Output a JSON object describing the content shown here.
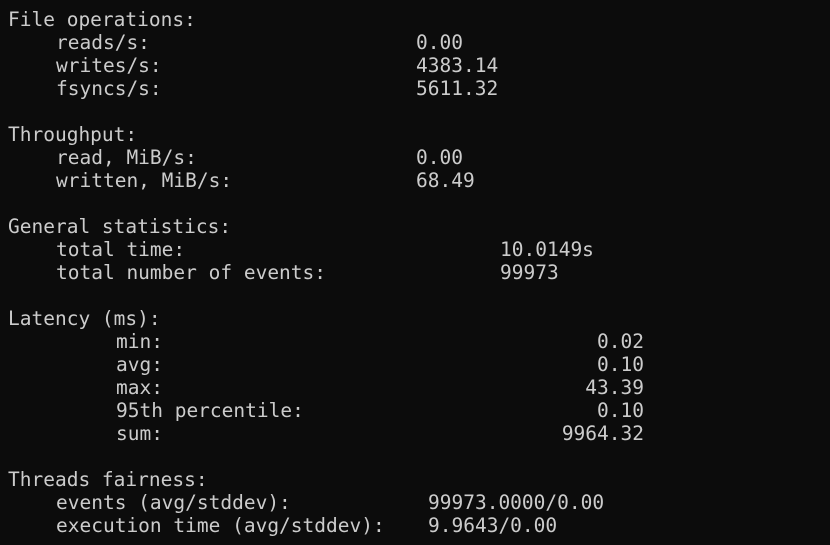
{
  "file_operations": {
    "header": "File operations:",
    "rows": [
      {
        "label": "reads/s:",
        "value": "0.00"
      },
      {
        "label": "writes/s:",
        "value": "4383.14"
      },
      {
        "label": "fsyncs/s:",
        "value": "5611.32"
      }
    ]
  },
  "throughput": {
    "header": "Throughput:",
    "rows": [
      {
        "label": "read, MiB/s:",
        "value": "0.00"
      },
      {
        "label": "written, MiB/s:",
        "value": "68.49"
      }
    ]
  },
  "general_statistics": {
    "header": "General statistics:",
    "rows": [
      {
        "label": "total time:",
        "value": "10.0149s"
      },
      {
        "label": "total number of events:",
        "value": "99973"
      }
    ]
  },
  "latency": {
    "header": "Latency (ms):",
    "rows": [
      {
        "label": "min:",
        "value": "0.02"
      },
      {
        "label": "avg:",
        "value": "0.10"
      },
      {
        "label": "max:",
        "value": "43.39"
      },
      {
        "label": "95th percentile:",
        "value": "0.10"
      },
      {
        "label": "sum:",
        "value": "9964.32"
      }
    ]
  },
  "threads_fairness": {
    "header": "Threads fairness:",
    "rows": [
      {
        "label": "events (avg/stddev):",
        "value": "99973.0000/0.00"
      },
      {
        "label": "execution time (avg/stddev):",
        "value": "9.9643/0.00"
      }
    ]
  }
}
